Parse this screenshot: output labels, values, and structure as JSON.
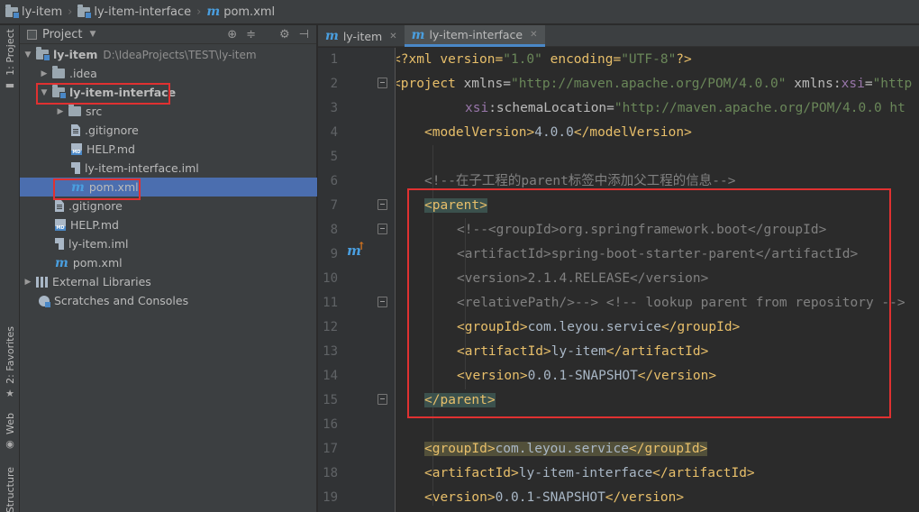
{
  "breadcrumb": {
    "items": [
      {
        "label": "ly-item",
        "icon": "folder-icon"
      },
      {
        "label": "ly-item-interface",
        "icon": "module-folder-icon"
      },
      {
        "label": "pom.xml",
        "icon": "maven-icon"
      }
    ]
  },
  "left_strip": {
    "project_tab": "1: Project",
    "favorites_tab": "2: Favorites",
    "web_tab": "Web",
    "structure_tab": "Structure"
  },
  "project_panel": {
    "title": "Project",
    "tree": [
      {
        "label": "ly-item",
        "hint": "D:\\IdeaProjects\\TEST\\ly-item",
        "icon": "module-folder-icon",
        "expanded": true
      },
      {
        "label": ".idea",
        "icon": "folder-icon",
        "expanded": false
      },
      {
        "label": "ly-item-interface",
        "icon": "module-folder-icon",
        "expanded": true
      },
      {
        "label": "src",
        "icon": "folder-icon",
        "expanded": false
      },
      {
        "label": ".gitignore",
        "icon": "text-file-icon"
      },
      {
        "label": "HELP.md",
        "icon": "markdown-file-icon"
      },
      {
        "label": "ly-item-interface.iml",
        "icon": "iml-file-icon"
      },
      {
        "label": "pom.xml",
        "icon": "maven-icon",
        "selected": true
      },
      {
        "label": ".gitignore",
        "icon": "text-file-icon"
      },
      {
        "label": "HELP.md",
        "icon": "markdown-file-icon"
      },
      {
        "label": "ly-item.iml",
        "icon": "iml-file-icon"
      },
      {
        "label": "pom.xml",
        "icon": "maven-icon"
      },
      {
        "label": "External Libraries",
        "icon": "library-icon",
        "expanded": false
      },
      {
        "label": "Scratches and Consoles",
        "icon": "scratch-icon"
      }
    ]
  },
  "editor": {
    "tabs": [
      {
        "label": "ly-item",
        "active": false
      },
      {
        "label": "ly-item-interface",
        "active": true
      }
    ],
    "line_numbers": [
      "1",
      "2",
      "3",
      "4",
      "5",
      "6",
      "7",
      "8",
      "9",
      "10",
      "11",
      "12",
      "13",
      "14",
      "15",
      "16",
      "17",
      "18",
      "19"
    ],
    "code": {
      "l1_a": "<?xml version=",
      "l1_b": "\"1.0\"",
      "l1_c": " encoding=",
      "l1_d": "\"UTF-8\"",
      "l1_e": "?>",
      "l2_a": "<project ",
      "l2_b": "xmlns=",
      "l2_c": "\"http://maven.apache.org/POM/4.0.0\"",
      "l2_d": " xmlns:",
      "l2_e": "xsi",
      "l2_f": "=",
      "l2_g": "\"http",
      "l3_a": "xsi",
      "l3_b": ":schemaLocation=",
      "l3_c": "\"http://maven.apache.org/POM/4.0.0 ht",
      "l4_a": "<modelVersion>",
      "l4_b": "4.0.0",
      "l4_c": "</modelVersion>",
      "l6": "<!--在子工程的parent标签中添加父工程的信息-->",
      "l7": "<parent>",
      "l8": "<!--<groupId>org.springframework.boot</groupId>",
      "l9": "<artifactId>spring-boot-starter-parent</artifactId>",
      "l10": "<version>2.1.4.RELEASE</version>",
      "l11_a": "<relativePath/>-->",
      "l11_b": " <!-- lookup parent from repository -->",
      "l12_a": "<groupId>",
      "l12_b": "com.leyou.service",
      "l12_c": "</groupId>",
      "l13_a": "<artifactId>",
      "l13_b": "ly-item",
      "l13_c": "</artifactId>",
      "l14_a": "<version>",
      "l14_b": "0.0.1-SNAPSHOT",
      "l14_c": "</version>",
      "l15": "</parent>",
      "l17_a": "<groupId>",
      "l17_b": "com.leyou.service",
      "l17_c": "</groupId>",
      "l18_a": "<artifactId>",
      "l18_b": "ly-item-interface",
      "l18_c": "</artifactId>",
      "l19_a": "<version>",
      "l19_b": "0.0.1-SNAPSHOT",
      "l19_c": "</version>"
    }
  },
  "colors": {
    "annotation_red": "#e03131",
    "selection_blue": "#4b6eaf",
    "xml_tag": "#e8bf6a",
    "xml_value": "#6a8759",
    "comment": "#808080"
  }
}
